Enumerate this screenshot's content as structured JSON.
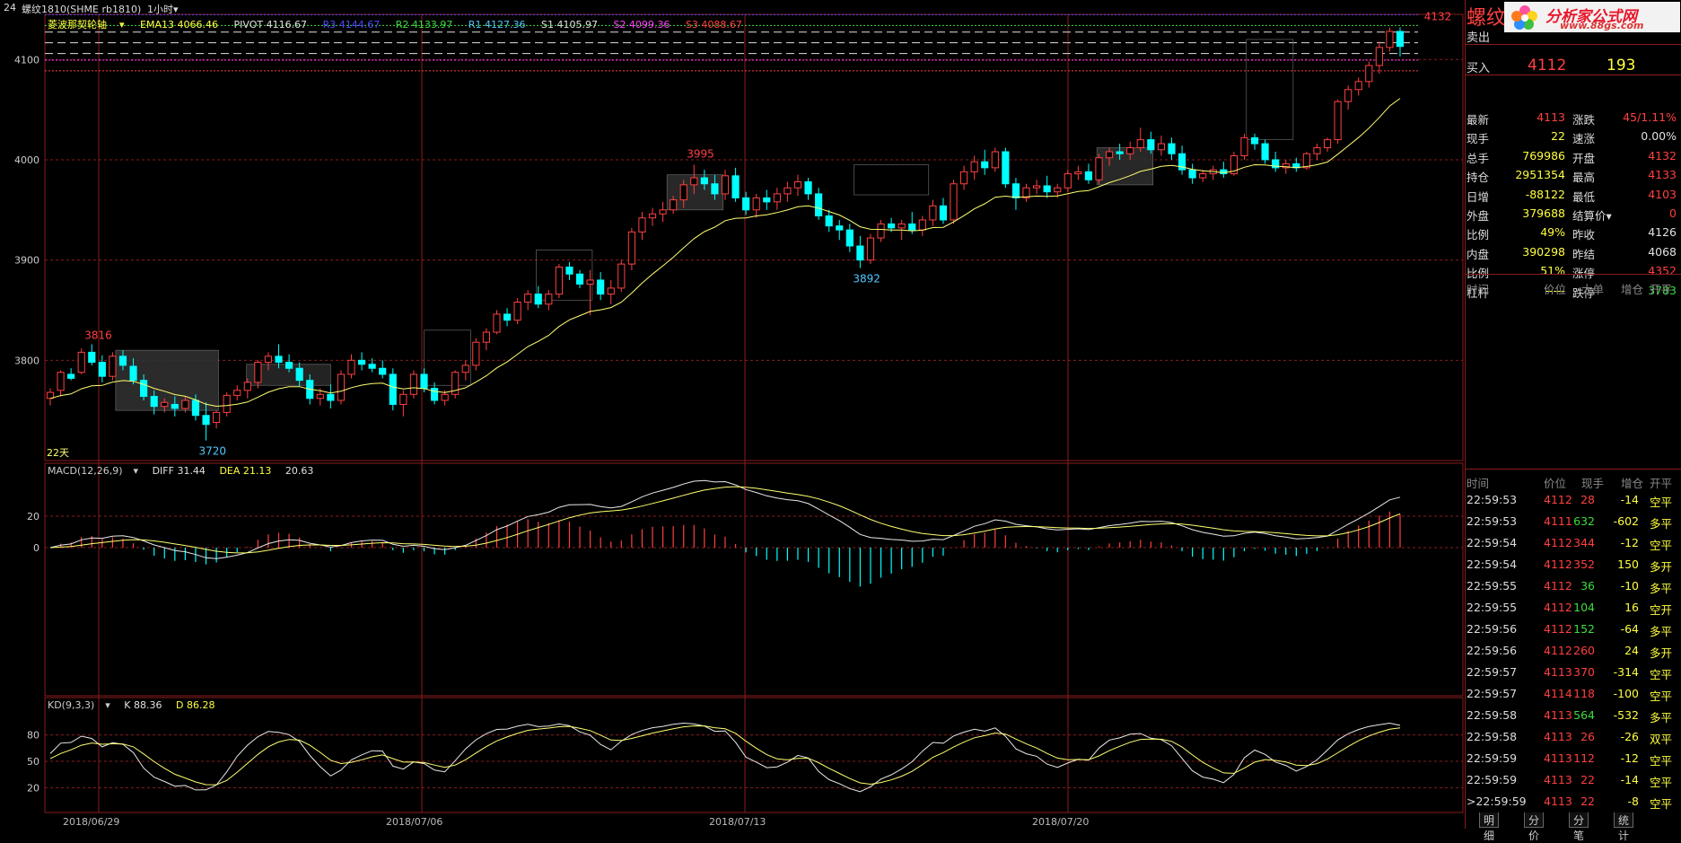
{
  "header": {
    "window_no": "24",
    "symbol": "螺纹1810(SHME rb1810)",
    "period": "1小时"
  },
  "main_indicator": {
    "name": "菱波那契轮轴",
    "ema": "EMA13 4066.46",
    "pivot": "PIVOT 4116.67",
    "r3": "R3 4144.67",
    "r2": "R2 4133.97",
    "r1": "R1 4127.36",
    "s1": "S1 4105.97",
    "s2": "S2 4099.36",
    "s3": "S3 4088.67",
    "days_label": "22天",
    "y_ticks": [
      "4100",
      "4000",
      "3900",
      "3800"
    ],
    "annotations": [
      "3816",
      "3720",
      "3995",
      "3892",
      "4132"
    ]
  },
  "macd": {
    "name": "MACD(12,26,9)",
    "diff": "DIFF 31.44",
    "dea": "DEA 21.13",
    "macd": "20.63",
    "y_ticks": [
      "20",
      "0"
    ]
  },
  "kd": {
    "name": "KD(9,3,3)",
    "k": "K 88.36",
    "d": "D 86.28",
    "y_ticks": [
      "80",
      "50",
      "20"
    ]
  },
  "x_dates": [
    "2018/06/29",
    "2018/07/06",
    "2018/07/13",
    "2018/07/20"
  ],
  "colors": {
    "up": "#ff4040",
    "down": "#00ffff",
    "grid": "#8a1c1c",
    "r3": "#4a4aff",
    "r2": "#3fdc3f",
    "r1": "#4fc8ff",
    "s2": "#ff40ff",
    "s3": "#ff4040"
  },
  "chart_data": {
    "type": "candlestick",
    "candles": [
      [
        3762,
        3772,
        3755,
        3768
      ],
      [
        3770,
        3790,
        3764,
        3788
      ],
      [
        3786,
        3792,
        3780,
        3782
      ],
      [
        3788,
        3812,
        3786,
        3808
      ],
      [
        3808,
        3816,
        3795,
        3798
      ],
      [
        3798,
        3805,
        3778,
        3784
      ],
      [
        3784,
        3808,
        3780,
        3804
      ],
      [
        3804,
        3810,
        3790,
        3795
      ],
      [
        3794,
        3802,
        3776,
        3780
      ],
      [
        3780,
        3786,
        3760,
        3764
      ],
      [
        3764,
        3770,
        3746,
        3754
      ],
      [
        3754,
        3762,
        3748,
        3758
      ],
      [
        3756,
        3764,
        3744,
        3752
      ],
      [
        3752,
        3764,
        3748,
        3760
      ],
      [
        3760,
        3766,
        3740,
        3745
      ],
      [
        3745,
        3758,
        3720,
        3736
      ],
      [
        3738,
        3750,
        3732,
        3748
      ],
      [
        3748,
        3768,
        3744,
        3765
      ],
      [
        3765,
        3775,
        3760,
        3770
      ],
      [
        3770,
        3782,
        3762,
        3778
      ],
      [
        3778,
        3800,
        3772,
        3798
      ],
      [
        3798,
        3808,
        3790,
        3804
      ],
      [
        3804,
        3816,
        3792,
        3798
      ],
      [
        3798,
        3806,
        3788,
        3792
      ],
      [
        3792,
        3798,
        3774,
        3780
      ],
      [
        3780,
        3786,
        3756,
        3762
      ],
      [
        3762,
        3772,
        3755,
        3766
      ],
      [
        3766,
        3776,
        3752,
        3760
      ],
      [
        3760,
        3790,
        3756,
        3786
      ],
      [
        3786,
        3806,
        3782,
        3800
      ],
      [
        3800,
        3808,
        3790,
        3796
      ],
      [
        3796,
        3802,
        3788,
        3792
      ],
      [
        3792,
        3800,
        3782,
        3786
      ],
      [
        3786,
        3792,
        3750,
        3756
      ],
      [
        3756,
        3770,
        3744,
        3766
      ],
      [
        3766,
        3790,
        3762,
        3786
      ],
      [
        3786,
        3792,
        3768,
        3772
      ],
      [
        3772,
        3778,
        3756,
        3760
      ],
      [
        3760,
        3770,
        3755,
        3766
      ],
      [
        3766,
        3790,
        3762,
        3788
      ],
      [
        3788,
        3800,
        3780,
        3795
      ],
      [
        3795,
        3822,
        3790,
        3818
      ],
      [
        3818,
        3832,
        3810,
        3828
      ],
      [
        3828,
        3850,
        3826,
        3846
      ],
      [
        3846,
        3852,
        3834,
        3840
      ],
      [
        3840,
        3862,
        3836,
        3858
      ],
      [
        3858,
        3870,
        3850,
        3866
      ],
      [
        3866,
        3874,
        3852,
        3856
      ],
      [
        3856,
        3870,
        3850,
        3866
      ],
      [
        3866,
        3896,
        3862,
        3893
      ],
      [
        3893,
        3898,
        3880,
        3886
      ],
      [
        3886,
        3890,
        3872,
        3876
      ],
      [
        3876,
        3890,
        3845,
        3880
      ],
      [
        3880,
        3888,
        3860,
        3866
      ],
      [
        3866,
        3880,
        3856,
        3872
      ],
      [
        3872,
        3900,
        3868,
        3896
      ],
      [
        3896,
        3932,
        3890,
        3928
      ],
      [
        3928,
        3948,
        3920,
        3942
      ],
      [
        3942,
        3952,
        3934,
        3946
      ],
      [
        3946,
        3958,
        3938,
        3950
      ],
      [
        3950,
        3964,
        3946,
        3960
      ],
      [
        3960,
        3980,
        3952,
        3975
      ],
      [
        3975,
        3995,
        3966,
        3982
      ],
      [
        3982,
        3990,
        3970,
        3976
      ],
      [
        3976,
        3985,
        3960,
        3966
      ],
      [
        3966,
        3990,
        3960,
        3984
      ],
      [
        3984,
        3992,
        3958,
        3962
      ],
      [
        3962,
        3968,
        3945,
        3950
      ],
      [
        3950,
        3966,
        3942,
        3962
      ],
      [
        3962,
        3970,
        3950,
        3958
      ],
      [
        3958,
        3972,
        3950,
        3966
      ],
      [
        3966,
        3978,
        3958,
        3972
      ],
      [
        3972,
        3985,
        3964,
        3978
      ],
      [
        3978,
        3982,
        3960,
        3966
      ],
      [
        3966,
        3972,
        3940,
        3944
      ],
      [
        3944,
        3950,
        3928,
        3934
      ],
      [
        3934,
        3940,
        3920,
        3930
      ],
      [
        3930,
        3936,
        3908,
        3914
      ],
      [
        3914,
        3924,
        3892,
        3900
      ],
      [
        3900,
        3926,
        3896,
        3922
      ],
      [
        3922,
        3940,
        3918,
        3936
      ],
      [
        3936,
        3942,
        3928,
        3932
      ],
      [
        3932,
        3940,
        3920,
        3936
      ],
      [
        3936,
        3948,
        3926,
        3930
      ],
      [
        3930,
        3944,
        3924,
        3940
      ],
      [
        3940,
        3960,
        3934,
        3954
      ],
      [
        3954,
        3962,
        3936,
        3940
      ],
      [
        3940,
        3980,
        3936,
        3976
      ],
      [
        3976,
        3994,
        3970,
        3988
      ],
      [
        3988,
        4004,
        3980,
        3998
      ],
      [
        3998,
        4010,
        3985,
        3992
      ],
      [
        3992,
        4012,
        3988,
        4008
      ],
      [
        4008,
        4012,
        3972,
        3976
      ],
      [
        3976,
        3982,
        3950,
        3962
      ],
      [
        3962,
        3976,
        3958,
        3972
      ],
      [
        3972,
        3980,
        3966,
        3974
      ],
      [
        3974,
        3984,
        3962,
        3968
      ],
      [
        3968,
        3976,
        3962,
        3972
      ],
      [
        3972,
        3990,
        3968,
        3986
      ],
      [
        3986,
        3994,
        3980,
        3988
      ],
      [
        3988,
        3996,
        3976,
        3980
      ],
      [
        3980,
        4006,
        3976,
        4002
      ],
      [
        4002,
        4012,
        3994,
        4008
      ],
      [
        4008,
        4016,
        4000,
        4006
      ],
      [
        4006,
        4018,
        4000,
        4012
      ],
      [
        4012,
        4032,
        4008,
        4020
      ],
      [
        4020,
        4028,
        4006,
        4010
      ],
      [
        4010,
        4024,
        4004,
        4016
      ],
      [
        4016,
        4022,
        4000,
        4006
      ],
      [
        4006,
        4014,
        3985,
        3990
      ],
      [
        3990,
        3996,
        3976,
        3982
      ],
      [
        3982,
        3990,
        3978,
        3986
      ],
      [
        3986,
        3994,
        3980,
        3990
      ],
      [
        3990,
        3998,
        3982,
        3986
      ],
      [
        3986,
        4008,
        3984,
        4004
      ],
      [
        4004,
        4026,
        4000,
        4022
      ],
      [
        4022,
        4026,
        4010,
        4016
      ],
      [
        4016,
        4020,
        3996,
        4000
      ],
      [
        4000,
        4008,
        3988,
        3992
      ],
      [
        3992,
        4000,
        3986,
        3996
      ],
      [
        3996,
        4002,
        3988,
        3992
      ],
      [
        3992,
        4008,
        3990,
        4006
      ],
      [
        4006,
        4016,
        4000,
        4012
      ],
      [
        4012,
        4022,
        4008,
        4020
      ],
      [
        4020,
        4060,
        4016,
        4058
      ],
      [
        4058,
        4074,
        4050,
        4070
      ],
      [
        4070,
        4082,
        4064,
        4078
      ],
      [
        4078,
        4098,
        4072,
        4094
      ],
      [
        4094,
        4118,
        4086,
        4112
      ],
      [
        4112,
        4132,
        4108,
        4128
      ],
      [
        4128,
        4132,
        4103,
        4113
      ]
    ]
  },
  "panel": {
    "title": "螺纹",
    "logo_text": "分析家公式网",
    "logo_url_text": "www.88gs.com",
    "sell": {
      "label": "卖出",
      "price": "",
      "vol": ""
    },
    "buy": {
      "label": "买入",
      "price": "4112",
      "vol": "193"
    },
    "stats": [
      {
        "l1": "最新",
        "v1": "4113",
        "c1": "#ff4040",
        "l2": "涨跌",
        "v2": "45/1.11%",
        "c2": "#ff4040"
      },
      {
        "l1": "现手",
        "v1": "22",
        "c1": "#ffff40",
        "l2": "速涨",
        "v2": "0.00%",
        "c2": "#e0e0e0"
      },
      {
        "l1": "总手",
        "v1": "769986",
        "c1": "#ffff40",
        "l2": "开盘",
        "v2": "4132",
        "c2": "#ff4040"
      },
      {
        "l1": "持仓",
        "v1": "2951354",
        "c1": "#ffff40",
        "l2": "最高",
        "v2": "4133",
        "c2": "#ff4040"
      },
      {
        "l1": "日增",
        "v1": "-88122",
        "c1": "#ffff40",
        "l2": "最低",
        "v2": "4103",
        "c2": "#ff4040"
      },
      {
        "l1": "外盘",
        "v1": "379688",
        "c1": "#ffff40",
        "l2": "结算价▾",
        "v2": "0",
        "c2": "#ff4040"
      },
      {
        "l1": "比例",
        "v1": "49%",
        "c1": "#ffff40",
        "l2": "昨收",
        "v2": "4126",
        "c2": "#e0e0e0"
      },
      {
        "l1": "内盘",
        "v1": "390298",
        "c1": "#ffff40",
        "l2": "昨结",
        "v2": "4068",
        "c2": "#e0e0e0"
      },
      {
        "l1": "比例",
        "v1": "51%",
        "c1": "#ffff40",
        "l2": "涨停",
        "v2": "4352",
        "c2": "#ff4040"
      },
      {
        "l1": "杠杆",
        "v1": "-----",
        "c1": "#ffff40",
        "l2": "跌停",
        "v2": "3783",
        "c2": "#3fdc3f"
      }
    ],
    "hdr1": [
      "时间",
      "价位",
      "大单",
      "增仓",
      "开平"
    ],
    "hdr2": [
      "时间",
      "价位",
      "现手",
      "增仓",
      "开平"
    ],
    "ticks": [
      {
        "t": "22:59:53",
        "p": "4112",
        "v": "28",
        "vc": "#ff4040",
        "d": "-14",
        "k": "空平"
      },
      {
        "t": "22:59:53",
        "p": "4111",
        "v": "632",
        "vc": "#3fdc3f",
        "d": "-602",
        "k": "多平"
      },
      {
        "t": "22:59:54",
        "p": "4112",
        "v": "344",
        "vc": "#ff4040",
        "d": "-12",
        "k": "空平"
      },
      {
        "t": "22:59:54",
        "p": "4112",
        "v": "352",
        "vc": "#ff4040",
        "d": "150",
        "k": "多开"
      },
      {
        "t": "22:59:55",
        "p": "4112",
        "v": "36",
        "vc": "#3fdc3f",
        "d": "-10",
        "k": "多平"
      },
      {
        "t": "22:59:55",
        "p": "4112",
        "v": "104",
        "vc": "#3fdc3f",
        "d": "16",
        "k": "空开"
      },
      {
        "t": "22:59:56",
        "p": "4112",
        "v": "152",
        "vc": "#3fdc3f",
        "d": "-64",
        "k": "多平"
      },
      {
        "t": "22:59:56",
        "p": "4112",
        "v": "260",
        "vc": "#ff4040",
        "d": "24",
        "k": "多开"
      },
      {
        "t": "22:59:57",
        "p": "4113",
        "v": "370",
        "vc": "#ff4040",
        "d": "-314",
        "k": "空平"
      },
      {
        "t": "22:59:57",
        "p": "4114",
        "v": "118",
        "vc": "#ff4040",
        "d": "-100",
        "k": "空平"
      },
      {
        "t": "22:59:58",
        "p": "4113",
        "v": "564",
        "vc": "#3fdc3f",
        "d": "-532",
        "k": "多平"
      },
      {
        "t": "22:59:58",
        "p": "4113",
        "v": "26",
        "vc": "#ff4040",
        "d": "-26",
        "k": "双平"
      },
      {
        "t": "22:59:59",
        "p": "4113",
        "v": "112",
        "vc": "#ff4040",
        "d": "-12",
        "k": "空平"
      },
      {
        "t": "22:59:59",
        "p": "4113",
        "v": "22",
        "vc": "#ff4040",
        "d": "-14",
        "k": "空平"
      },
      {
        "t": ">22:59:59",
        "p": "4113",
        "v": "22",
        "vc": "#ff4040",
        "d": "-8",
        "k": "空平"
      }
    ],
    "tabs": [
      "明细",
      "分价",
      "分笔",
      "统计"
    ]
  }
}
